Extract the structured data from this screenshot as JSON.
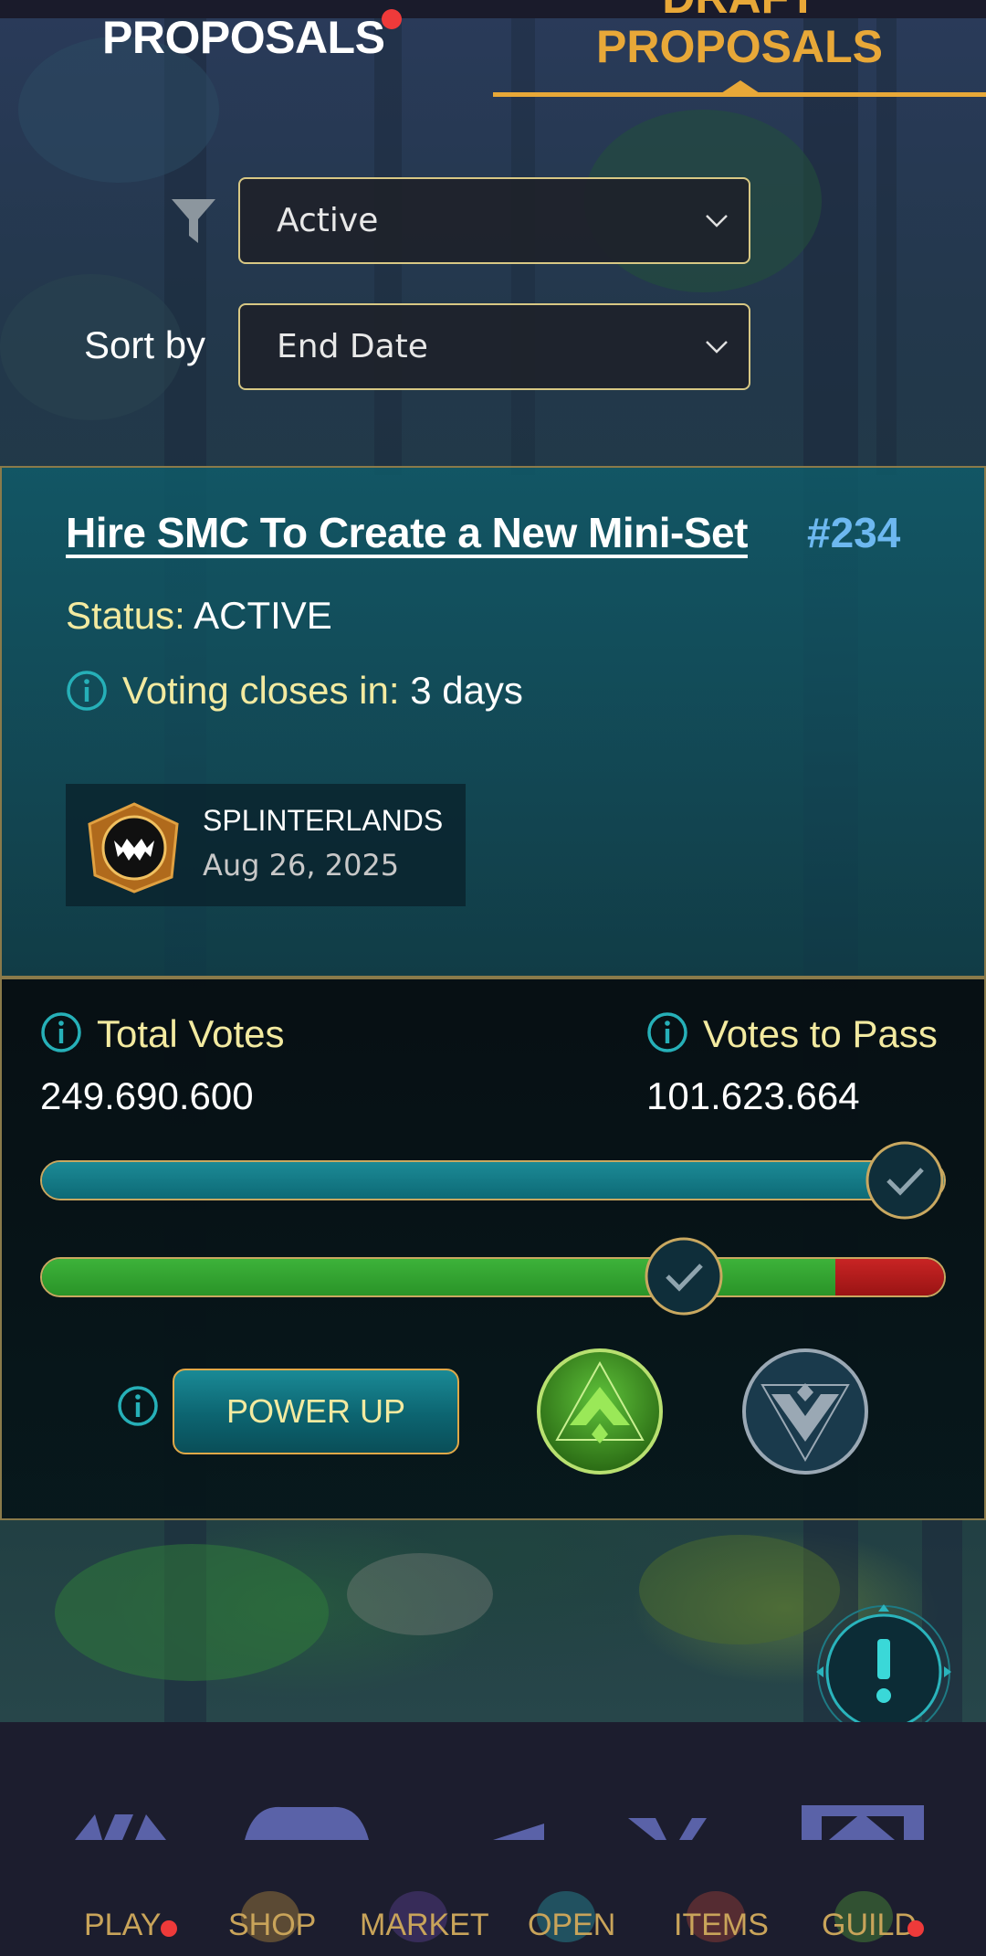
{
  "tabs": {
    "proposals": "PROPOSALS",
    "draft_line1": "DRAFT",
    "draft_line2": "PROPOSALS"
  },
  "filters": {
    "status_value": "Active",
    "sort_label": "Sort by",
    "sort_value": "End Date"
  },
  "proposal": {
    "title": "Hire SMC To Create a New Mini-Set",
    "number": "#234",
    "status_label": "Status:",
    "status_value": "ACTIVE",
    "voting_label": "Voting closes in:",
    "voting_value": "3 days",
    "author": "SPLINTERLANDS",
    "date": "Aug 26, 2025"
  },
  "votes": {
    "total_label": "Total Votes",
    "total_value": "249.690.600",
    "pass_label": "Votes to Pass",
    "pass_value": "101.623.664",
    "total_progress_fraction": 1.0,
    "approve_fraction": 0.88
  },
  "actions": {
    "power_up_label": "POWER UP"
  },
  "nav": {
    "items": [
      "PLAY",
      "SHOP",
      "MARKET",
      "OPEN",
      "ITEMS",
      "GUILD"
    ]
  },
  "colors": {
    "accent_gold": "#e8a838",
    "link_blue": "#6db8f0",
    "label_yellow": "#f3eaa0",
    "teal": "#1c8a96",
    "approve_green": "#3db23a",
    "reject_red": "#c82424",
    "notification_red": "#ee3a3a"
  }
}
